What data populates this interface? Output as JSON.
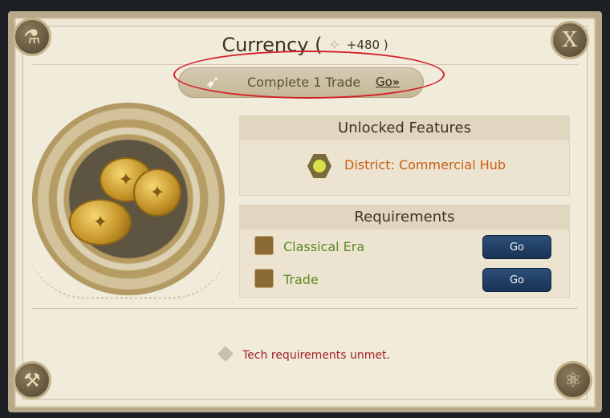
{
  "title": {
    "text": "Currency (",
    "amount": "+480 )"
  },
  "task": {
    "label": "Complete 1 Trade",
    "go": "Go",
    "chevrons": "»"
  },
  "close_label": "X",
  "unlocked": {
    "heading": "Unlocked Features",
    "feature": "District: Commercial Hub"
  },
  "requirements": {
    "heading": "Requirements",
    "items": [
      {
        "label": "Classical Era",
        "button": "Go"
      },
      {
        "label": "Trade",
        "button": "Go"
      }
    ]
  },
  "warning": "Tech requirements unmet."
}
